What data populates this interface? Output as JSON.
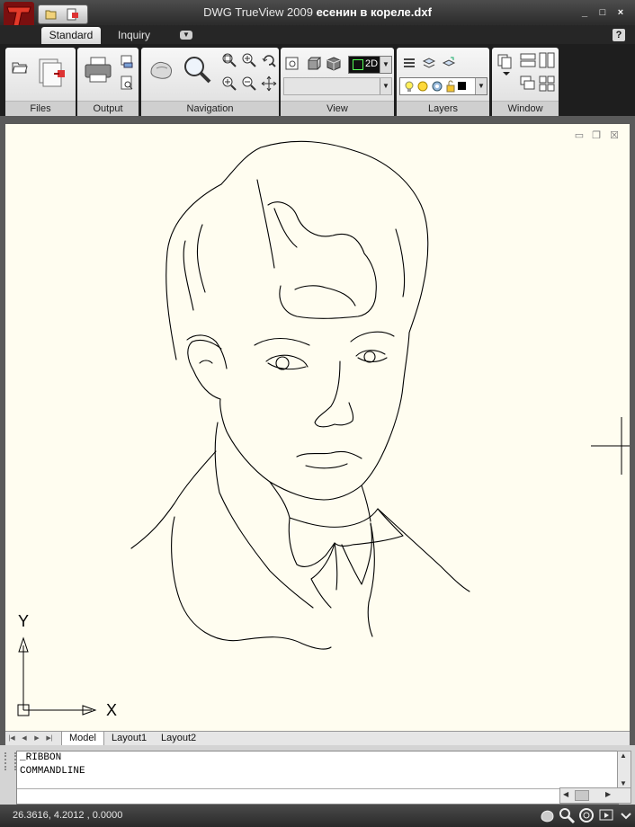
{
  "window": {
    "app_name": "DWG TrueView 2009",
    "file_name": "есенин в кореле.dxf",
    "controls": [
      "_",
      "□",
      "×"
    ]
  },
  "ribbon_tabs": [
    {
      "label": "Standard",
      "active": true
    },
    {
      "label": "Inquiry",
      "active": false
    }
  ],
  "ribbon_tab_menu_icon": "dropdown-arrow-icon",
  "help_label": "?",
  "panels": {
    "files": {
      "title": "Files",
      "icons": [
        "open-icon",
        "batch-publish-icon"
      ]
    },
    "output": {
      "title": "Output",
      "icons": [
        "plot-icon",
        "publish-icon",
        "plot-preview-icon"
      ]
    },
    "navigation": {
      "title": "Navigation",
      "icons": [
        "pan-icon",
        "zoom-realtime-icon",
        "zoom-window-icon",
        "zoom-extents-icon",
        "zoom-previous-icon",
        "zoom-in-icon",
        "zoom-out-icon",
        "orbit-icon"
      ]
    },
    "view": {
      "title": "View",
      "icons": [
        "named-views-icon",
        "shade-icon",
        "3d-box-icon"
      ],
      "mode_value": "2D",
      "named_view_value": ""
    },
    "layers": {
      "title": "Layers",
      "icons": [
        "layer-properties-icon",
        "layer-states-icon",
        "layer-previous-icon",
        "bulb-icon",
        "sun-icon",
        "gear-icon",
        "lock-icon",
        "color-swatch-icon"
      ]
    },
    "window": {
      "title": "Window",
      "icons": [
        "switch-windows-icon",
        "tile-horizontal-icon",
        "tile-vertical-icon",
        "cascade-icon",
        "arrange-icon"
      ]
    }
  },
  "layout_tabs": [
    {
      "label": "Model",
      "active": true
    },
    {
      "label": "Layout1",
      "active": false
    },
    {
      "label": "Layout2",
      "active": false
    }
  ],
  "ucs": {
    "x_label": "X",
    "y_label": "Y"
  },
  "command_history": [
    "_RIBBON",
    "COMMANDLINE"
  ],
  "command_input": "",
  "status": {
    "coordinates": "26.3616, 4.2012 , 0.0000"
  },
  "colors": {
    "canvas": "#fffdf0",
    "ribbon_bg": "#1e1e1e",
    "accent_red": "#c0392b"
  }
}
